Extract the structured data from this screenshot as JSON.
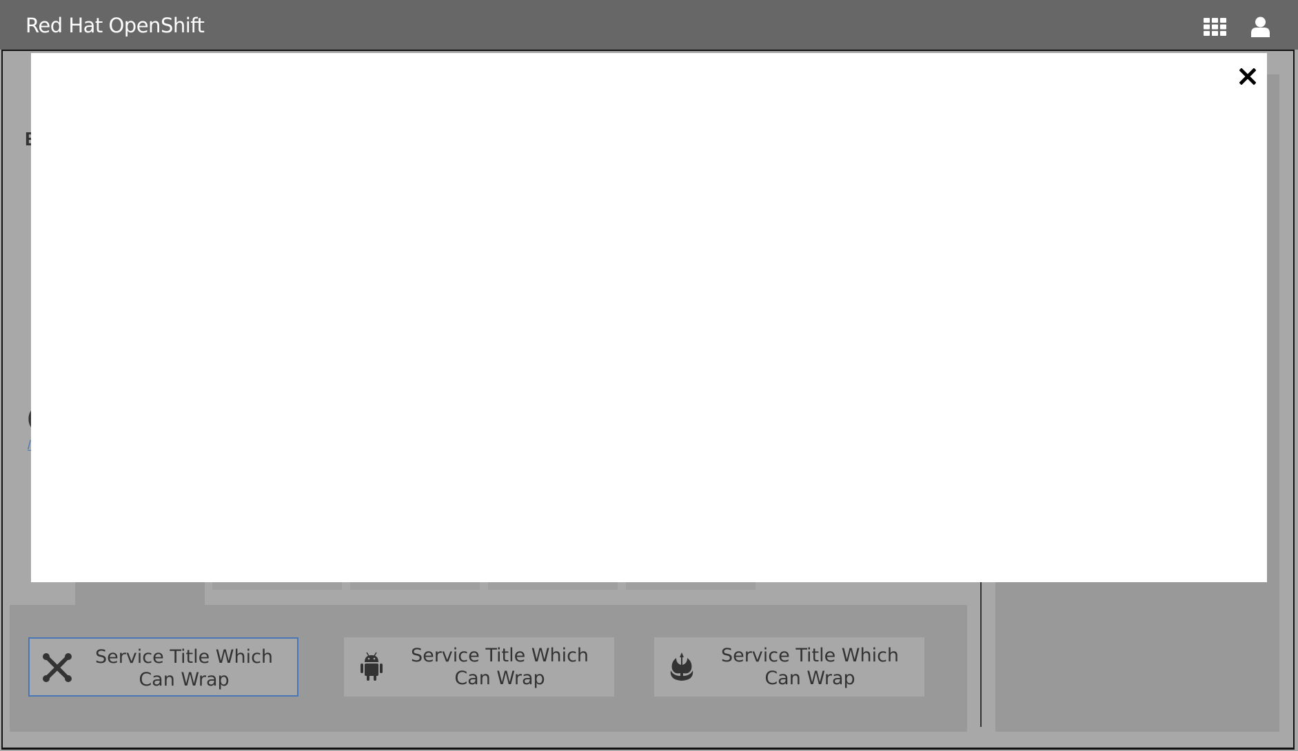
{
  "header": {
    "title": "Red Hat OpenShift",
    "icons": [
      "grid-icon",
      "user-icon"
    ]
  },
  "background": {
    "partial_heading_1": "E",
    "partial_heading_2": "(",
    "partial_link": "/"
  },
  "services": [
    {
      "title": "Service Title Which Can Wrap",
      "icon": "joomla-icon",
      "selected": true
    },
    {
      "title": "Service Title Which Can Wrap",
      "icon": "android-icon",
      "selected": false
    },
    {
      "title": "Service Title Which Can Wrap",
      "icon": "rebel-icon",
      "selected": false
    }
  ],
  "modal": {
    "close_icon": "close-icon"
  },
  "colors": {
    "header": "#676767",
    "selected_border": "#4a76b5",
    "modal": "#ffffff"
  }
}
